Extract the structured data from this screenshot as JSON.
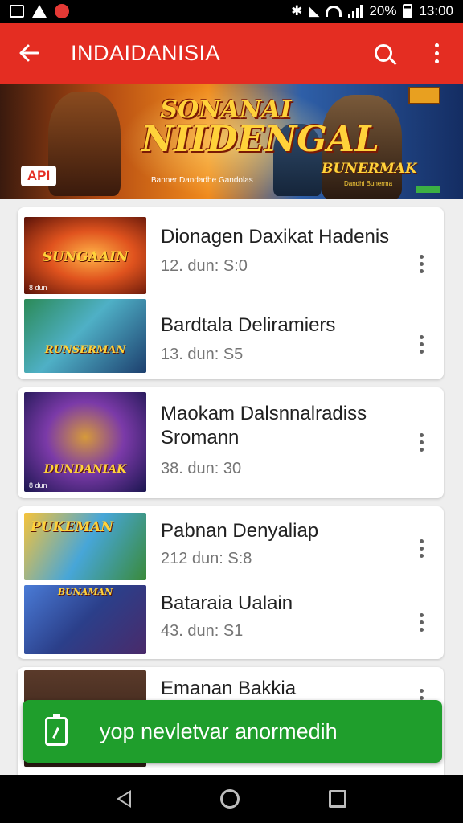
{
  "status_bar": {
    "battery_text": "20%",
    "time": "13:00",
    "notification_icons": [
      "gallery-icon",
      "recycle-icon",
      "record-icon"
    ]
  },
  "app_bar": {
    "title": "INDAIDANISIA",
    "back_icon": "arrow-back-icon",
    "search_icon": "search-icon",
    "menu_icon": "more-vertical-icon",
    "color": "#e42d22"
  },
  "banner": {
    "title_line1": "SONANAI",
    "title_line2": "NIIDENGAL",
    "caption": "Banner Dandadhe Gandolas",
    "logo": "BUNERMAK",
    "logo_sub": "Dandhi Bunerma",
    "badge": "API"
  },
  "cards": [
    {
      "items": [
        {
          "title": "Dionagen Daxikat Hadenis",
          "meta": "12. dun: S:0",
          "thumb_label": "SUNGAAIN",
          "thumb_tag": "8 dun"
        },
        {
          "title": "Bardtala Deliramiers",
          "meta": "13. dun: S5",
          "thumb_label": "RUNSERMAN",
          "thumb_tag": ""
        }
      ]
    },
    {
      "items": [
        {
          "title": "Maokam Dalsnnalradiss Sromann",
          "meta": "38. dun: 30",
          "thumb_label": "DUNDANIAK",
          "thumb_tag": "8 dun"
        }
      ]
    },
    {
      "items": [
        {
          "title": "Pabnan Denyaliap",
          "meta": "212 dun: S:8",
          "thumb_label": "PUKEMAN",
          "thumb_tag": ""
        },
        {
          "title": "Bataraia Ualain",
          "meta": "43. dun: S1",
          "thumb_label": "BUNAMAN",
          "thumb_tag": ""
        }
      ]
    },
    {
      "items": [
        {
          "title": "Emanan Bakkia",
          "meta": "",
          "thumb_label": "",
          "thumb_tag": ""
        }
      ]
    }
  ],
  "snackbar": {
    "text": "yop nevletvar anormedih",
    "icon": "battery-icon",
    "color": "#1f9e2c"
  },
  "nav_bar": {
    "back_icon": "nav-back-icon",
    "home_icon": "nav-home-icon",
    "recents_icon": "nav-recents-icon"
  }
}
